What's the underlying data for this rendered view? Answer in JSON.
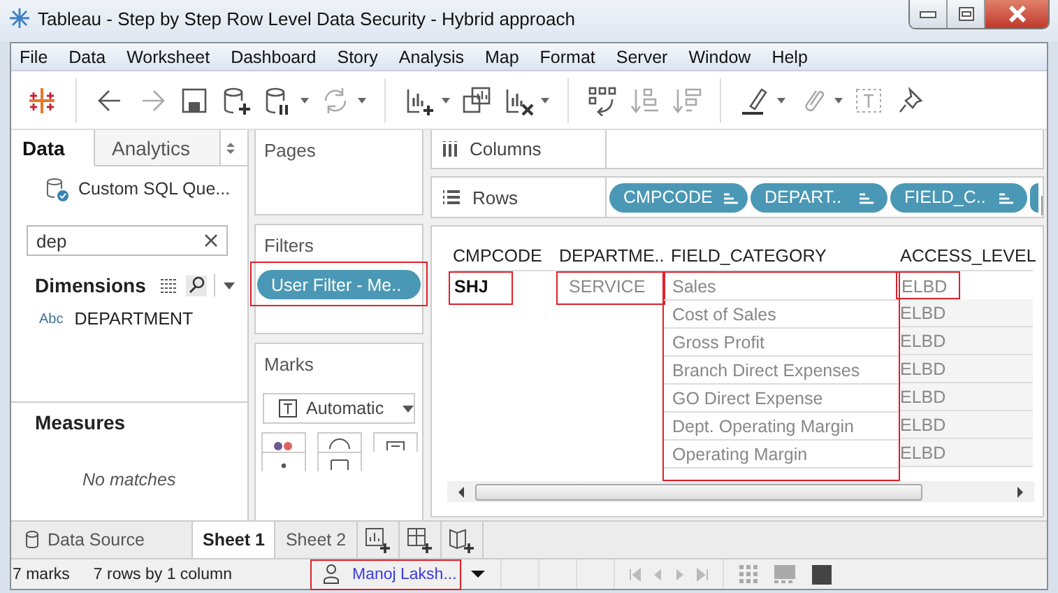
{
  "window": {
    "title": "Tableau - Step by Step Row Level Data Security - Hybrid approach"
  },
  "menu": [
    {
      "label": "File"
    },
    {
      "label": "Data"
    },
    {
      "label": "Worksheet"
    },
    {
      "label": "Dashboard"
    },
    {
      "label": "Story"
    },
    {
      "label": "Analysis"
    },
    {
      "label": "Map"
    },
    {
      "label": "Format"
    },
    {
      "label": "Server"
    },
    {
      "label": "Window"
    },
    {
      "label": "Help"
    }
  ],
  "data_pane": {
    "tabs": [
      {
        "label": "Data",
        "selected": true
      },
      {
        "label": "Analytics",
        "selected": false
      }
    ],
    "datasource": "Custom SQL Que...",
    "search": {
      "value": "dep"
    },
    "dimensions": {
      "title": "Dimensions",
      "items": [
        {
          "type": "Abc",
          "name": "DEPARTMENT"
        }
      ]
    },
    "measures": {
      "title": "Measures",
      "empty_text": "No matches"
    }
  },
  "pages": {
    "title": "Pages"
  },
  "filters": {
    "title": "Filters",
    "pills": [
      {
        "label": "User Filter - Me..",
        "highlighted": true
      }
    ]
  },
  "marks": {
    "title": "Marks",
    "mark_type": "Automatic"
  },
  "columns_shelf": {
    "title": "Columns"
  },
  "rows_shelf": {
    "title": "Rows",
    "pills": [
      {
        "label": "CMPCODE"
      },
      {
        "label": "DEPART.."
      },
      {
        "label": "FIELD_C.."
      }
    ]
  },
  "table": {
    "columns": [
      {
        "label": "CMPCODE",
        "highlighted": false
      },
      {
        "label": "DEPARTME..",
        "highlighted": false
      },
      {
        "label": "FIELD_CATEGORY",
        "highlighted": true
      },
      {
        "label": "ACCESS_LEVEL",
        "highlighted": false
      }
    ],
    "rows": [
      {
        "cells": [
          {
            "text": "SHJ",
            "highlighted": true
          },
          {
            "text": "SERVICE",
            "highlighted": true
          },
          {
            "text": "Sales",
            "highlighted": false
          },
          {
            "text": "ELBD",
            "highlighted": true
          }
        ]
      },
      {
        "cells": [
          null,
          null,
          {
            "text": "Cost of Sales",
            "highlighted": false
          },
          {
            "text": "ELBD",
            "highlighted": false
          }
        ]
      },
      {
        "cells": [
          null,
          null,
          {
            "text": "Gross Profit",
            "highlighted": false
          },
          {
            "text": "ELBD",
            "highlighted": false
          }
        ]
      },
      {
        "cells": [
          null,
          null,
          {
            "text": "Branch Direct Expenses",
            "highlighted": false
          },
          {
            "text": "ELBD",
            "highlighted": false
          }
        ]
      },
      {
        "cells": [
          null,
          null,
          {
            "text": "GO Direct Expense",
            "highlighted": false
          },
          {
            "text": "ELBD",
            "highlighted": false
          }
        ]
      },
      {
        "cells": [
          null,
          null,
          {
            "text": "Dept. Operating Margin",
            "highlighted": false
          },
          {
            "text": "ELBD",
            "highlighted": false
          }
        ]
      },
      {
        "cells": [
          null,
          null,
          {
            "text": "Operating Margin",
            "highlighted": false
          },
          {
            "text": "ELBD",
            "highlighted": false
          }
        ]
      }
    ]
  },
  "sheet_tabs": [
    {
      "label": "Data Source",
      "kind": "datasource",
      "selected": false
    },
    {
      "label": "Sheet 1",
      "kind": "sheet",
      "selected": true
    },
    {
      "label": "Sheet 2",
      "kind": "sheet",
      "selected": false
    }
  ],
  "status_bar": {
    "marks": "7 marks",
    "dimensions": "7 rows by 1 column",
    "user": {
      "name": "Manoj Laksh...",
      "highlighted": true
    }
  }
}
